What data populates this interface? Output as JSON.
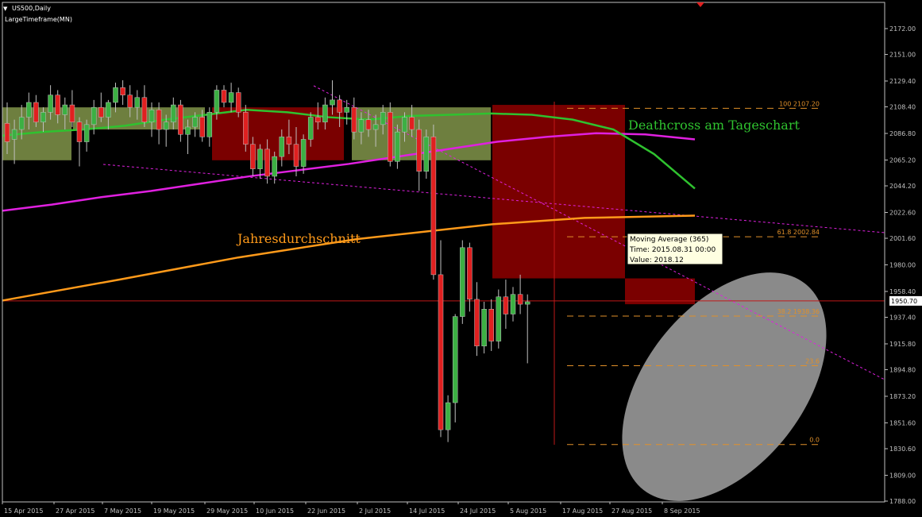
{
  "header": {
    "symbol": "US500,Daily",
    "indicator": "LargeTimeframe(MN)",
    "menu_arrow": "▼"
  },
  "annotations": {
    "deathcross": "Deathcross am Tageschart",
    "jahres": "Jahresdurchschnitt"
  },
  "tooltip": {
    "line1": "Moving Average (365)",
    "line2": "Time: 2015.08.31 00:00",
    "line3": "Value: 2018.12"
  },
  "colors": {
    "background": "#000000",
    "grid_axis": "#c0c0c0",
    "up_candle": "#3cb043",
    "down_candle": "#e02020",
    "ma_green": "#2fc22f",
    "ma_magenta": "#e020e0",
    "ma_orange": "#ff9a1a",
    "price_line": "#c01818",
    "fib": "#e0902a",
    "box_green": "#6e7f3f",
    "box_red": "#7a0000",
    "ellipse": "#8a8a8a"
  },
  "chart_data": {
    "type": "line",
    "title": "",
    "ylim": [
      1788.0,
      2180.0
    ],
    "y_ticks": [
      "2172.00",
      "2151.00",
      "2129.40",
      "2108.40",
      "2086.80",
      "2065.20",
      "2044.20",
      "2022.60",
      "2001.60",
      "1980.00",
      "1958.40",
      "1937.40",
      "1915.80",
      "1894.80",
      "1873.20",
      "1851.60",
      "1830.60",
      "1809.00",
      "1788.00"
    ],
    "x_ticks": [
      "15 Apr 2015",
      "27 Apr 2015",
      "7 May 2015",
      "19 May 2015",
      "29 May 2015",
      "10 Jun 2015",
      "22 Jun 2015",
      "2 Jul 2015",
      "14 Jul 2015",
      "24 Jul 2015",
      "5 Aug 2015",
      "17 Aug 2015",
      "27 Aug 2015",
      "8 Sep 2015"
    ],
    "current_price": {
      "value": 1950.7,
      "label": "1950.70"
    },
    "fibonacci": [
      {
        "level": "100",
        "price": 2107.2,
        "label": "2107.20"
      },
      {
        "level": "61.8",
        "price": 2002.84,
        "label": "2002.84"
      },
      {
        "level": "38.2",
        "price": 1938.36,
        "label": "1938.36"
      },
      {
        "level": "23.6",
        "price": 1898.0,
        "label": ""
      },
      {
        "level": "0.0",
        "price": 1834.0,
        "label": ""
      }
    ],
    "series": [
      {
        "name": "Moving Average (365)",
        "values": [
          1951,
          1968,
          1986,
          2001,
          2013,
          2018.12,
          2020
        ]
      }
    ],
    "ma_fast": [
      2085,
      2088,
      2090,
      2093,
      2098,
      2102,
      2106,
      2104,
      2100,
      2098,
      2101,
      2102,
      2103,
      2102,
      2098,
      2090,
      2070,
      2042
    ],
    "ma_slow": [
      2024,
      2029,
      2035,
      2040,
      2046,
      2052,
      2057,
      2062,
      2068,
      2074,
      2080,
      2084,
      2087,
      2086,
      2082
    ],
    "ohlc": [
      [
        2095,
        2112,
        2070,
        2080
      ],
      [
        2082,
        2098,
        2062,
        2090
      ],
      [
        2090,
        2110,
        2082,
        2100
      ],
      [
        2100,
        2120,
        2090,
        2112
      ],
      [
        2112,
        2118,
        2092,
        2096
      ],
      [
        2096,
        2108,
        2088,
        2104
      ],
      [
        2104,
        2126,
        2098,
        2118
      ],
      [
        2118,
        2122,
        2095,
        2102
      ],
      [
        2102,
        2116,
        2090,
        2110
      ],
      [
        2110,
        2122,
        2092,
        2096
      ],
      [
        2096,
        2100,
        2060,
        2080
      ],
      [
        2080,
        2098,
        2072,
        2094
      ],
      [
        2094,
        2114,
        2086,
        2108
      ],
      [
        2108,
        2120,
        2096,
        2100
      ],
      [
        2100,
        2114,
        2090,
        2112
      ],
      [
        2112,
        2128,
        2104,
        2124
      ],
      [
        2124,
        2130,
        2110,
        2118
      ],
      [
        2118,
        2126,
        2100,
        2108
      ],
      [
        2108,
        2122,
        2098,
        2116
      ],
      [
        2116,
        2126,
        2092,
        2096
      ],
      [
        2096,
        2112,
        2084,
        2106
      ],
      [
        2106,
        2112,
        2078,
        2090
      ],
      [
        2090,
        2102,
        2076,
        2096
      ],
      [
        2096,
        2116,
        2090,
        2110
      ],
      [
        2110,
        2114,
        2080,
        2086
      ],
      [
        2086,
        2098,
        2070,
        2092
      ],
      [
        2092,
        2104,
        2084,
        2100
      ],
      [
        2100,
        2106,
        2080,
        2084
      ],
      [
        2084,
        2108,
        2076,
        2104
      ],
      [
        2104,
        2126,
        2098,
        2122
      ],
      [
        2122,
        2126,
        2108,
        2112
      ],
      [
        2112,
        2128,
        2104,
        2120
      ],
      [
        2120,
        2124,
        2100,
        2104
      ],
      [
        2104,
        2110,
        2072,
        2078
      ],
      [
        2078,
        2084,
        2052,
        2058
      ],
      [
        2058,
        2078,
        2050,
        2074
      ],
      [
        2074,
        2082,
        2046,
        2052
      ],
      [
        2052,
        2072,
        2046,
        2068
      ],
      [
        2068,
        2090,
        2060,
        2084
      ],
      [
        2084,
        2098,
        2070,
        2078
      ],
      [
        2078,
        2092,
        2052,
        2060
      ],
      [
        2060,
        2086,
        2054,
        2082
      ],
      [
        2082,
        2104,
        2076,
        2100
      ],
      [
        2100,
        2112,
        2090,
        2096
      ],
      [
        2096,
        2116,
        2090,
        2110
      ],
      [
        2110,
        2130,
        2102,
        2114
      ],
      [
        2114,
        2118,
        2092,
        2104
      ],
      [
        2104,
        2114,
        2094,
        2108
      ],
      [
        2108,
        2116,
        2082,
        2088
      ],
      [
        2088,
        2104,
        2078,
        2098
      ],
      [
        2098,
        2106,
        2084,
        2090
      ],
      [
        2090,
        2102,
        2076,
        2094
      ],
      [
        2094,
        2110,
        2086,
        2104
      ],
      [
        2104,
        2112,
        2060,
        2064
      ],
      [
        2064,
        2094,
        2058,
        2088
      ],
      [
        2088,
        2104,
        2080,
        2100
      ],
      [
        2100,
        2110,
        2084,
        2090
      ],
      [
        2090,
        2098,
        2040,
        2056
      ],
      [
        2056,
        2090,
        2050,
        2084
      ],
      [
        2084,
        2094,
        1968,
        1972
      ],
      [
        1972,
        2000,
        1840,
        1846
      ],
      [
        1846,
        1874,
        1836,
        1868
      ],
      [
        1868,
        1940,
        1852,
        1938
      ],
      [
        1938,
        2000,
        1932,
        1994
      ],
      [
        1994,
        1998,
        1942,
        1952
      ],
      [
        1952,
        1966,
        1906,
        1914
      ],
      [
        1914,
        1950,
        1908,
        1944
      ],
      [
        1944,
        1952,
        1910,
        1918
      ],
      [
        1918,
        1960,
        1912,
        1954
      ],
      [
        1954,
        1968,
        1928,
        1940
      ],
      [
        1940,
        1962,
        1934,
        1956
      ],
      [
        1956,
        1972,
        1940,
        1948
      ],
      [
        1948,
        1956,
        1900,
        1950
      ]
    ]
  }
}
